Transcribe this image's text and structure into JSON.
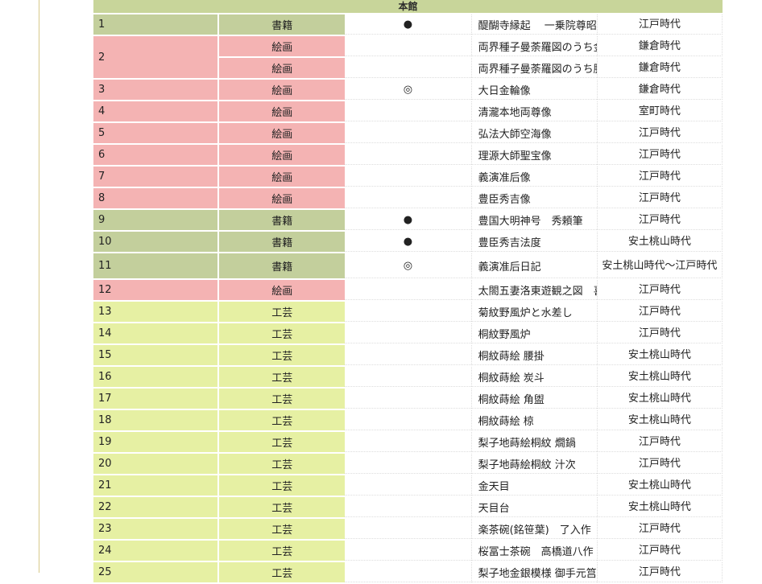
{
  "header": {
    "title": "本館"
  },
  "colors": {
    "shoseki": "#c3cf9c",
    "kaiga": "#f4b3b3",
    "kogei": "#e6f0a3"
  },
  "rows": [
    {
      "no": "1",
      "cat": "書籍",
      "cls": "c-shoseki",
      "mark": "●",
      "title": "醍醐寺縁起　 一乗院尊昭法親王本",
      "era": "江戸時代"
    },
    {
      "no": "2",
      "cat": "絵画",
      "cls": "c-kaiga",
      "mark": "",
      "title": "両界種子曼荼羅図のうち金剛界",
      "era": "鎌倉時代",
      "rowspan": 2
    },
    {
      "no": "",
      "cat": "絵画",
      "cls": "c-kaiga",
      "mark": "",
      "title": "両界種子曼荼羅図のうち胎蔵界",
      "era": "鎌倉時代",
      "continued": true
    },
    {
      "no": "3",
      "cat": "絵画",
      "cls": "c-kaiga",
      "mark": "◎",
      "title": "大日金輪像",
      "era": "鎌倉時代"
    },
    {
      "no": "4",
      "cat": "絵画",
      "cls": "c-kaiga",
      "mark": "",
      "title": "清瀧本地両尊像",
      "era": "室町時代"
    },
    {
      "no": "5",
      "cat": "絵画",
      "cls": "c-kaiga",
      "mark": "",
      "title": "弘法大師空海像",
      "era": "江戸時代"
    },
    {
      "no": "6",
      "cat": "絵画",
      "cls": "c-kaiga",
      "mark": "",
      "title": "理源大師聖宝像",
      "era": "江戸時代"
    },
    {
      "no": "7",
      "cat": "絵画",
      "cls": "c-kaiga",
      "mark": "",
      "title": "義演准后像",
      "era": "江戸時代"
    },
    {
      "no": "8",
      "cat": "絵画",
      "cls": "c-kaiga",
      "mark": "",
      "title": "豊臣秀吉像",
      "era": "江戸時代"
    },
    {
      "no": "9",
      "cat": "書籍",
      "cls": "c-shoseki",
      "mark": "●",
      "title": "豊国大明神号　秀頼筆",
      "era": "江戸時代"
    },
    {
      "no": "10",
      "cat": "書籍",
      "cls": "c-shoseki",
      "mark": "●",
      "title": "豊臣秀吉法度",
      "era": "安土桃山時代"
    },
    {
      "no": "11",
      "cat": "書籍",
      "cls": "c-shoseki",
      "mark": "◎",
      "title": "義演准后日記",
      "era": "安土桃山時代～江戸時代",
      "tall": true
    },
    {
      "no": "12",
      "cat": "絵画",
      "cls": "c-kaiga",
      "mark": "",
      "title": "太閤五妻洛東遊観之図　喜多川歌麿筆",
      "era": "江戸時代"
    },
    {
      "no": "13",
      "cat": "工芸",
      "cls": "c-kogei",
      "mark": "",
      "title": "菊紋野風炉と水差し",
      "era": "江戸時代"
    },
    {
      "no": "14",
      "cat": "工芸",
      "cls": "c-kogei",
      "mark": "",
      "title": "桐紋野風炉",
      "era": "江戸時代"
    },
    {
      "no": "15",
      "cat": "工芸",
      "cls": "c-kogei",
      "mark": "",
      "title": "桐紋蒔絵 腰掛",
      "era": "安土桃山時代"
    },
    {
      "no": "16",
      "cat": "工芸",
      "cls": "c-kogei",
      "mark": "",
      "title": "桐紋蒔絵 炭斗",
      "era": "安土桃山時代"
    },
    {
      "no": "17",
      "cat": "工芸",
      "cls": "c-kogei",
      "mark": "",
      "title": "桐紋蒔絵 角盥",
      "era": "安土桃山時代"
    },
    {
      "no": "18",
      "cat": "工芸",
      "cls": "c-kogei",
      "mark": "",
      "title": "桐紋蒔絵 椋",
      "era": "安土桃山時代"
    },
    {
      "no": "19",
      "cat": "工芸",
      "cls": "c-kogei",
      "mark": "",
      "title": "梨子地蒔絵桐紋 燗鍋",
      "era": "江戸時代"
    },
    {
      "no": "20",
      "cat": "工芸",
      "cls": "c-kogei",
      "mark": "",
      "title": "梨子地蒔絵桐紋 汁次",
      "era": "江戸時代"
    },
    {
      "no": "21",
      "cat": "工芸",
      "cls": "c-kogei",
      "mark": "",
      "title": "金天目",
      "era": "安土桃山時代"
    },
    {
      "no": "22",
      "cat": "工芸",
      "cls": "c-kogei",
      "mark": "",
      "title": "天目台",
      "era": "安土桃山時代"
    },
    {
      "no": "23",
      "cat": "工芸",
      "cls": "c-kogei",
      "mark": "",
      "title": "楽茶碗(銘笹葉)　了入作",
      "era": "江戸時代"
    },
    {
      "no": "24",
      "cat": "工芸",
      "cls": "c-kogei",
      "mark": "",
      "title": "桜冨士茶碗　高橋道八作",
      "era": "江戸時代"
    },
    {
      "no": "25",
      "cat": "工芸",
      "cls": "c-kogei",
      "mark": "",
      "title": "梨子地金銀模様 御手元筥",
      "era": "江戸時代"
    }
  ]
}
